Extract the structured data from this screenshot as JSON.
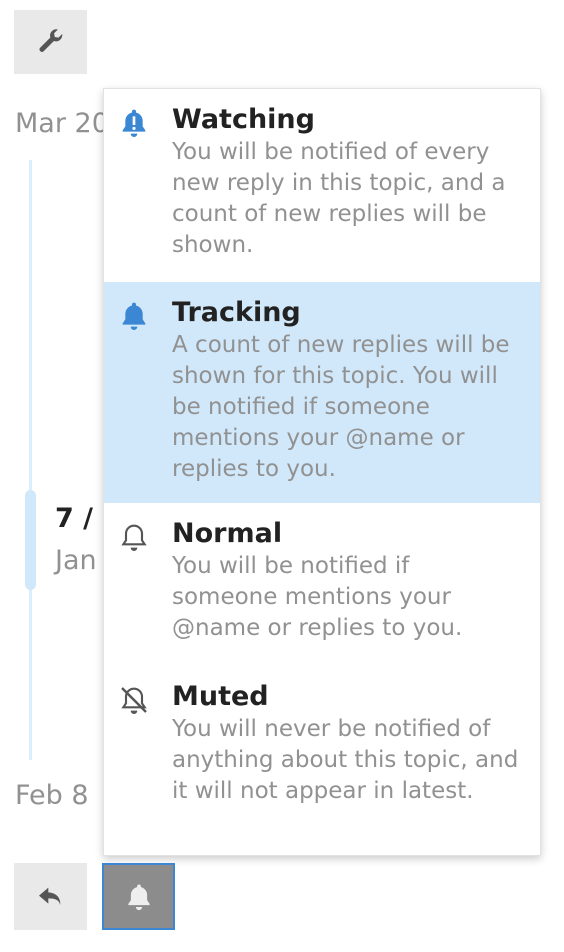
{
  "timeline": {
    "start_date": "Mar 20",
    "position": "7 /",
    "position_date": "Jan",
    "end_date": "Feb 8"
  },
  "buttons": {
    "admin": "wrench-icon",
    "reply": "reply-icon",
    "notifications": "bell-icon"
  },
  "menu": {
    "selected": "Tracking",
    "items": [
      {
        "title": "Watching",
        "description": "You will be notified of every new reply in this topic, and a count of new replies will be shown.",
        "icon": "bell-exclamation-icon"
      },
      {
        "title": "Tracking",
        "description": "A count of new replies will be shown for this topic. You will be notified if someone mentions your @name or replies to you.",
        "icon": "bell-filled-icon"
      },
      {
        "title": "Normal",
        "description": "You will be notified if someone mentions your @name or replies to you.",
        "icon": "bell-outline-icon"
      },
      {
        "title": "Muted",
        "description": "You will never be notified of anything about this topic, and it will not appear in latest.",
        "icon": "bell-slash-icon"
      }
    ]
  },
  "colors": {
    "accent": "#3b87d4",
    "highlight": "#d1e8fa"
  }
}
